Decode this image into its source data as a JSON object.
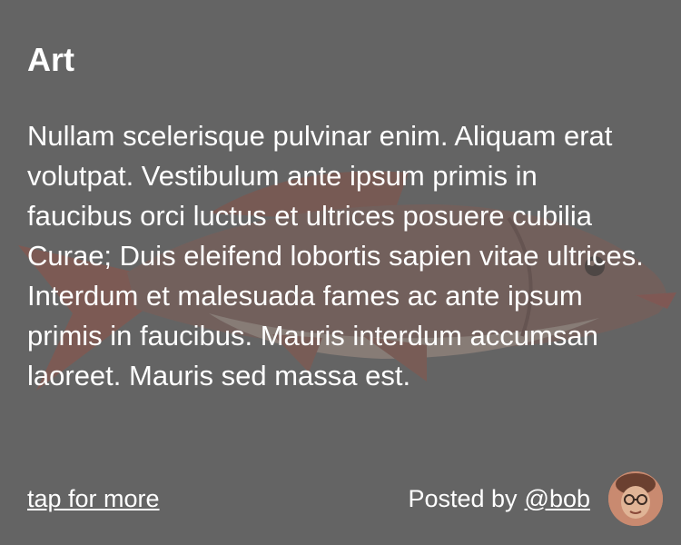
{
  "card": {
    "title": "Art",
    "body": "Nullam scelerisque pulvinar enim. Aliquam erat volutpat. Vestibulum ante ipsum primis in faucibus orci luctus et ultrices posuere cubilia Curae; Duis eleifend lobortis sapien vitae ultrices. Interdum et malesuada fames ac ante ipsum primis in faucibus. Mauris interdum accumsan laoreet. Mauris sed massa est.",
    "background_image": "fish-icon"
  },
  "footer": {
    "more_label": "tap for more",
    "posted_prefix": "Posted by",
    "author_handle": "@bob",
    "avatar_icon": "avatar-photo"
  },
  "colors": {
    "background": "#666666",
    "text": "#ffffff"
  }
}
